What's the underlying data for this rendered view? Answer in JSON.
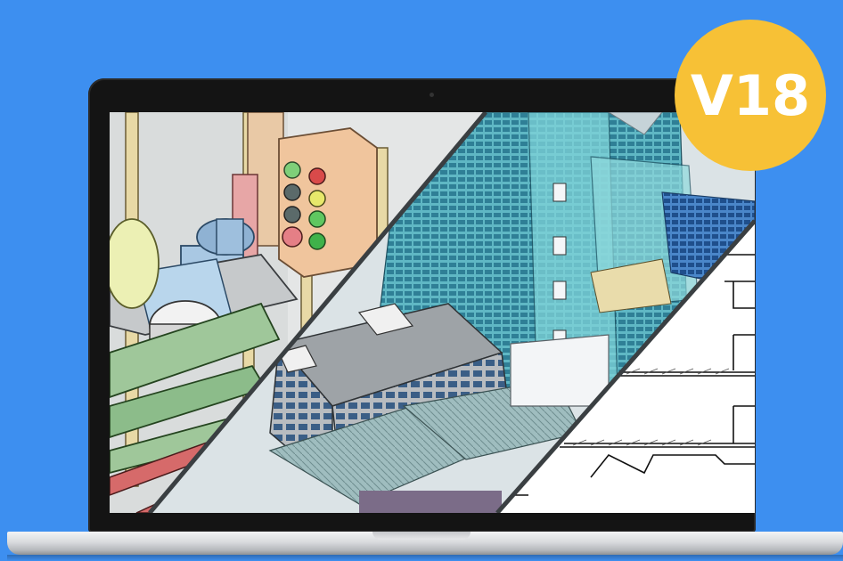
{
  "badge": {
    "label": "V18",
    "color": "#f7c136"
  },
  "background_color": "#3d8ff0",
  "screen": {
    "panels": [
      {
        "name": "mechanical-cad-view",
        "icon": "control-panel-assembly"
      },
      {
        "name": "building-bim-view",
        "icon": "city-building-model"
      },
      {
        "name": "drawing-2d-view",
        "icon": "technical-drawing"
      }
    ]
  }
}
